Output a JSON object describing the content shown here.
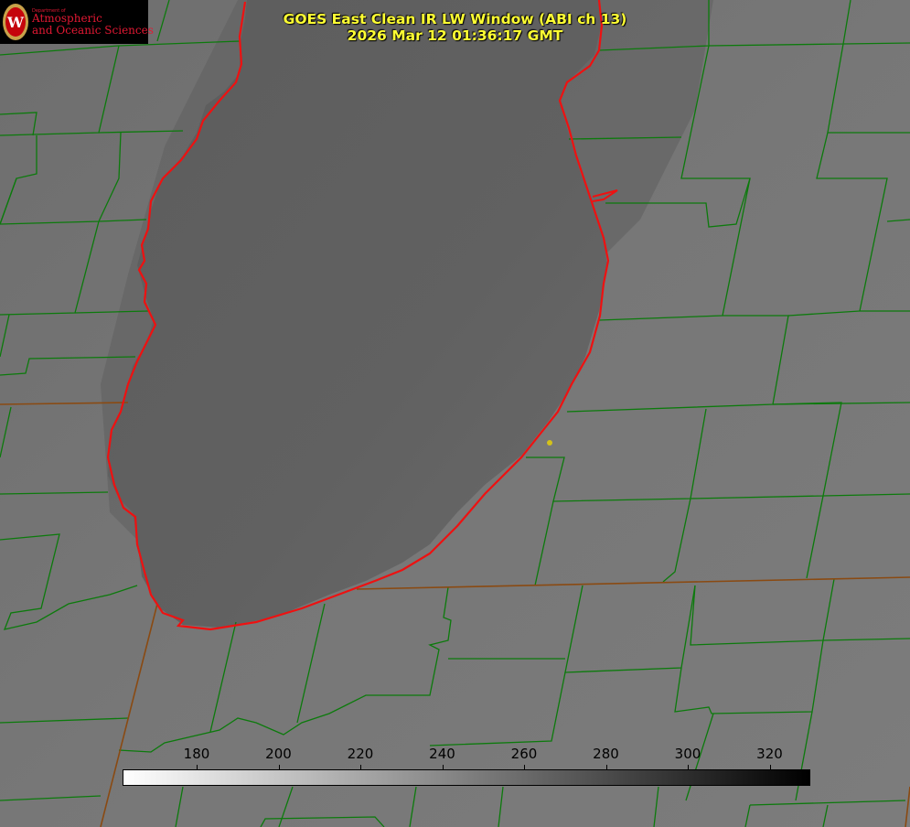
{
  "header": {
    "title_line1": "GOES East Clean IR LW Window (ABI ch 13)",
    "title_line2": "2026 Mar 12 01:36:17 GMT"
  },
  "logo": {
    "dept": "Department of",
    "line1": "Atmospheric",
    "line2": "and Oceanic Sciences"
  },
  "colorbar": {
    "ticks": [
      "180",
      "200",
      "220",
      "240",
      "260",
      "280",
      "300",
      "320"
    ],
    "gradient_start": "#ffffff",
    "gradient_end": "#000000"
  },
  "colors": {
    "lake_outline": "#ee1111",
    "county_lines": "#0c7a0c",
    "state_lines": "#8a4a12",
    "marker": "#d4c21a",
    "lake_fill": "#5f5f5f",
    "land_fill": "#7a7a7a"
  }
}
